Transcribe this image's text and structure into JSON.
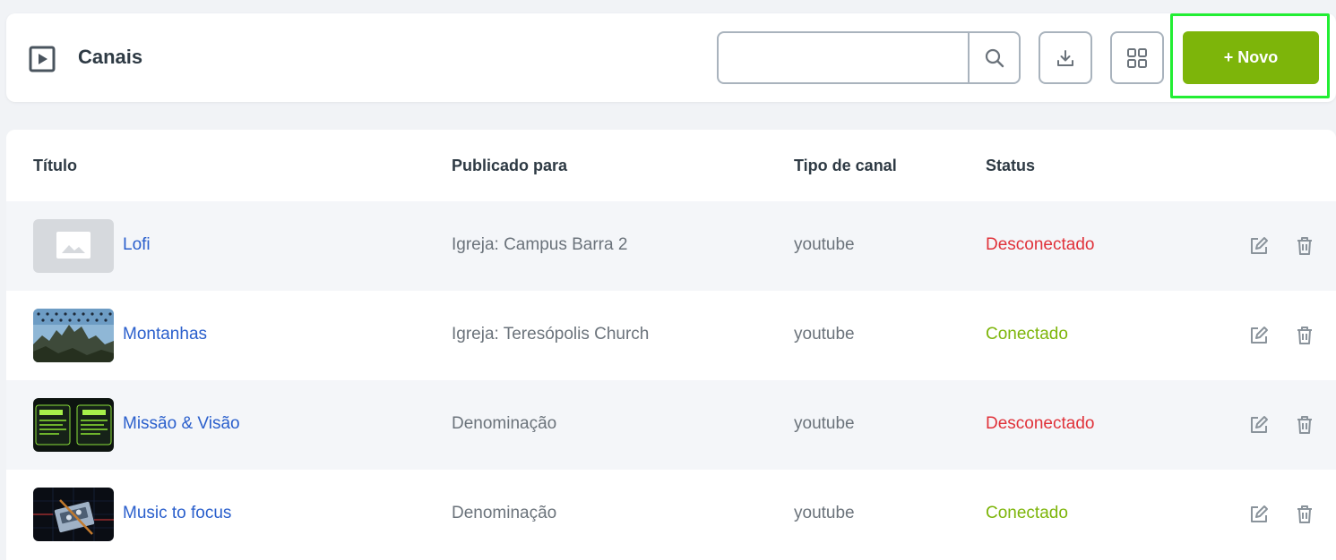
{
  "header": {
    "title": "Canais",
    "search_placeholder": "",
    "new_button_label": "+ Novo"
  },
  "table": {
    "columns": [
      "Título",
      "Publicado para",
      "Tipo de canal",
      "Status"
    ],
    "rows": [
      {
        "title": "Lofi",
        "published_to": "Igreja: Campus Barra 2",
        "channel_type": "youtube",
        "status": "Desconectado"
      },
      {
        "title": "Montanhas",
        "published_to": "Igreja: Teresópolis Church",
        "channel_type": "youtube",
        "status": "Conectado"
      },
      {
        "title": "Missão & Visão",
        "published_to": "Denominação",
        "channel_type": "youtube",
        "status": "Desconectado"
      },
      {
        "title": "Music to focus",
        "published_to": "Denominação",
        "channel_type": "youtube",
        "status": "Conectado"
      }
    ]
  },
  "colors": {
    "accent_green": "#7db50a",
    "link_blue": "#2a5fcc",
    "status_disconnected": "#e0323a",
    "status_connected": "#7db50a"
  },
  "icons": {
    "header": "play-square-icon",
    "search": "search-icon",
    "download": "download-icon",
    "grid": "grid-icon",
    "edit": "edit-icon",
    "delete": "trash-icon"
  }
}
